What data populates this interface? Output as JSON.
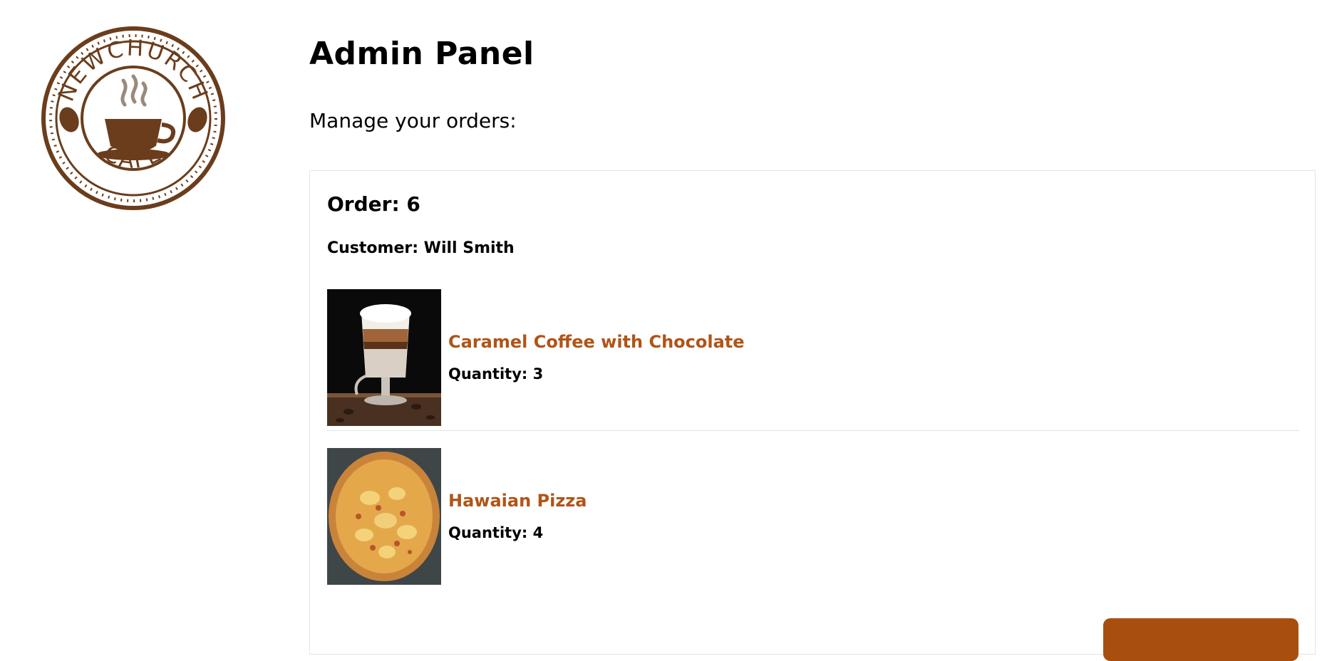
{
  "logo": {
    "text_top": "NEWCHURCH",
    "text_bottom": "CAFE",
    "color": "#6b3d1c"
  },
  "header": {
    "title": "Admin Panel",
    "subtitle": "Manage your orders:"
  },
  "order": {
    "title": "Order: 6",
    "customer": "Customer: Will Smith",
    "items": [
      {
        "name": "Caramel Coffee with Chocolate",
        "quantity": "Quantity: 3",
        "image_icon": "caramel-coffee-photo"
      },
      {
        "name": "Hawaian Pizza",
        "quantity": "Quantity: 4",
        "image_icon": "hawaian-pizza-photo"
      }
    ],
    "action_button_label": ""
  },
  "colors": {
    "accent": "#b05417",
    "button": "#a84f10",
    "border": "#e5e5e5"
  }
}
